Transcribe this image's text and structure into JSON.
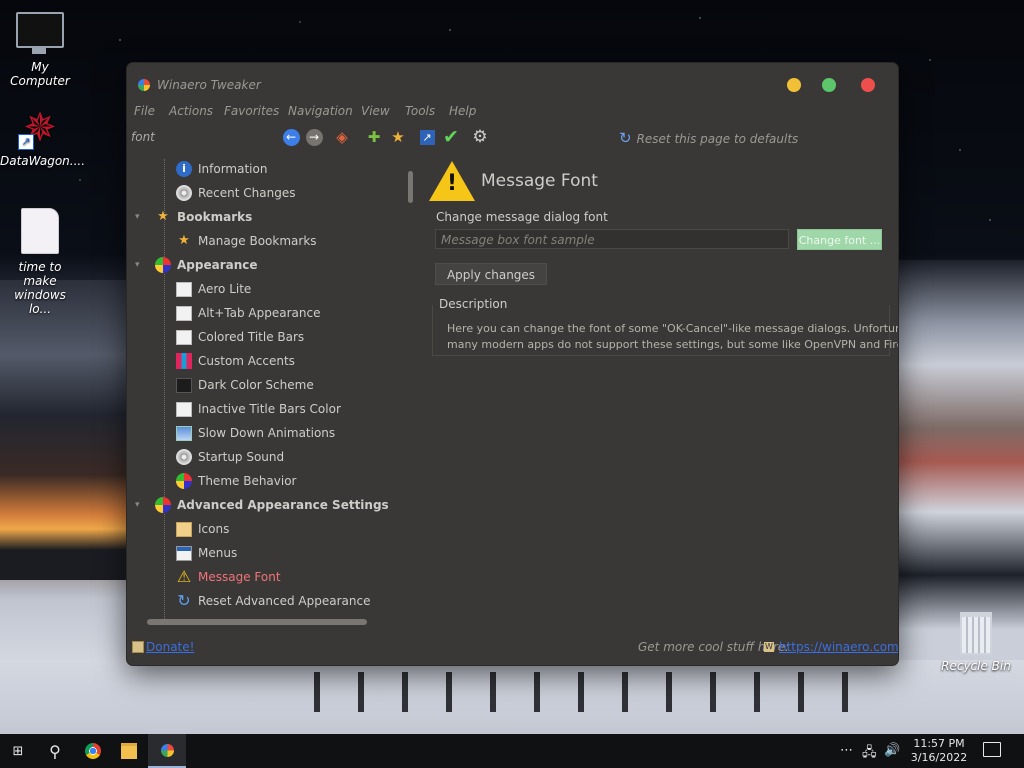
{
  "desktop": {
    "icons": [
      {
        "label": "My Computer"
      },
      {
        "label": "DataWagon...."
      },
      {
        "label": "time to make windows lo..."
      },
      {
        "label": "Recycle Bin"
      }
    ]
  },
  "window": {
    "title": "Winaero Tweaker",
    "menu": [
      "File",
      "Actions",
      "Favorites",
      "Navigation",
      "View",
      "Tools",
      "Help"
    ],
    "search": {
      "value": "font"
    },
    "reset_page": "Reset this page to defaults",
    "tree": [
      {
        "label": "Information",
        "icon": "info-icon"
      },
      {
        "label": "Recent Changes",
        "icon": "clock-icon"
      },
      {
        "label": "Bookmarks",
        "icon": "star-icon",
        "category": true
      },
      {
        "label": "Manage Bookmarks",
        "icon": "star-icon"
      },
      {
        "label": "Appearance",
        "icon": "palette-icon",
        "category": true
      },
      {
        "label": "Aero Lite",
        "icon": "window-icon"
      },
      {
        "label": "Alt+Tab Appearance",
        "icon": "window-icon"
      },
      {
        "label": "Colored Title Bars",
        "icon": "window-icon"
      },
      {
        "label": "Custom Accents",
        "icon": "accent-icon"
      },
      {
        "label": "Dark Color Scheme",
        "icon": "dark-window-icon"
      },
      {
        "label": "Inactive Title Bars Color",
        "icon": "window-icon"
      },
      {
        "label": "Slow Down Animations",
        "icon": "window-icon"
      },
      {
        "label": "Startup Sound",
        "icon": "speaker-icon"
      },
      {
        "label": "Theme Behavior",
        "icon": "palette-icon"
      },
      {
        "label": "Advanced Appearance Settings",
        "icon": "palette-icon",
        "category": true
      },
      {
        "label": "Icons",
        "icon": "folder-icon"
      },
      {
        "label": "Menus",
        "icon": "menu-icon"
      },
      {
        "label": "Message Font",
        "icon": "warning-icon",
        "selected": true
      },
      {
        "label": "Reset Advanced Appearance",
        "icon": "reset-icon"
      }
    ],
    "panel": {
      "title": "Message Font",
      "change_label": "Change message dialog font",
      "sample_text": "Message box font sample",
      "change_font_button": "Change font ...",
      "apply_button": "Apply changes",
      "description_title": "Description",
      "description_lines": [
        "Here you can change the font of some \"OK-Cancel\"-like message dialogs. Unfortunately,",
        "many modern apps do not support these settings, but some like OpenVPN and Firefox sti..."
      ]
    },
    "footer": {
      "donate": "Donate!",
      "more_text": "Get more cool stuff here:",
      "link": "https://winaero.com"
    }
  },
  "taskbar": {
    "time": "11:57 PM",
    "date": "3/16/2022",
    "tray_overflow": "⋯"
  },
  "colors": {
    "window_bg": "#3a3836",
    "selected_item": "#f07478",
    "change_font_button": "#9fd7a8",
    "link": "#3b6ee0"
  }
}
